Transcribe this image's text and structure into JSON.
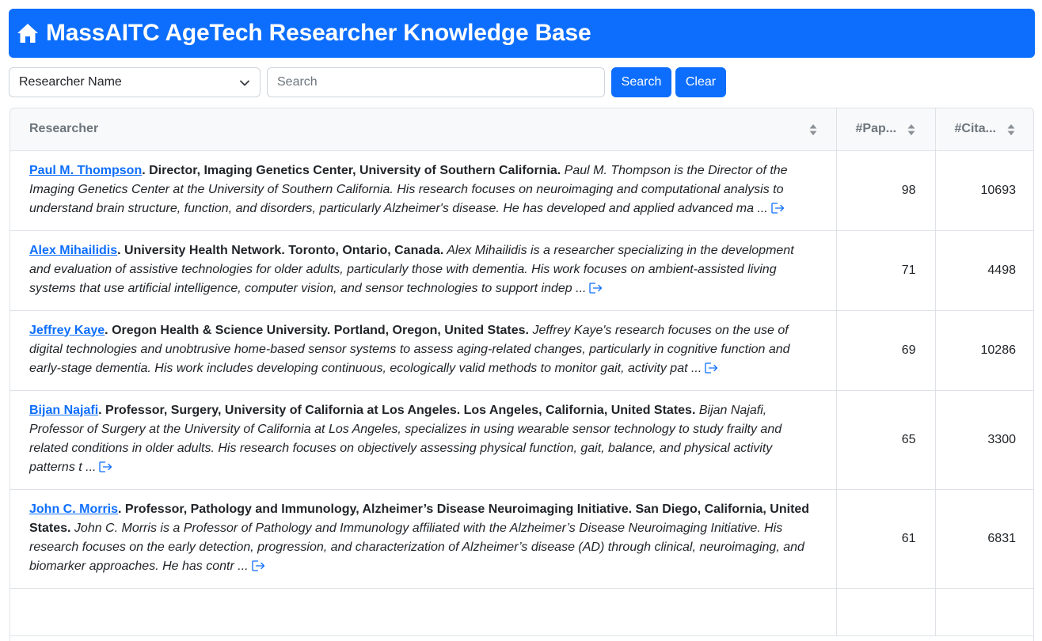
{
  "header": {
    "title": "MassAITC AgeTech Researcher Knowledge Base",
    "icon": "home-icon",
    "color": "#0d6efd"
  },
  "controls": {
    "field_select": {
      "selected": "Researcher Name"
    },
    "search": {
      "placeholder": "Search",
      "value": ""
    },
    "search_button": "Search",
    "clear_button": "Clear"
  },
  "table": {
    "columns": [
      "Researcher",
      "#Pap...",
      "#Cita..."
    ],
    "rows": [
      {
        "name": "Paul M. Thompson",
        "affiliation": ". Director, Imaging Genetics Center, University of Southern California.",
        "bio": " Paul M. Thompson is the Director of the Imaging Genetics Center at the University of Southern California. His research focuses on neuroimaging and computational analysis to understand brain structure, function, and disorders, particularly Alzheimer's disease. He has developed and applied advanced ma ...",
        "papers": "98",
        "citations": "10693"
      },
      {
        "name": "Alex Mihailidis",
        "affiliation": ". University Health Network. Toronto, Ontario, Canada.",
        "bio": " Alex Mihailidis is a researcher specializing in the development and evaluation of assistive technologies for older adults, particularly those with dementia. His work focuses on ambient-assisted living systems that use artificial intelligence, computer vision, and sensor technologies to support indep ...",
        "papers": "71",
        "citations": "4498"
      },
      {
        "name": "Jeffrey Kaye",
        "affiliation": ". Oregon Health & Science University. Portland, Oregon, United States.",
        "bio": " Jeffrey Kaye's research focuses on the use of digital technologies and unobtrusive home-based sensor systems to assess aging-related changes, particularly in cognitive function and early-stage dementia. His work includes developing continuous, ecologically valid methods to monitor gait, activity pat ...",
        "papers": "69",
        "citations": "10286"
      },
      {
        "name": "Bijan Najafi",
        "affiliation": ". Professor, Surgery, University of California at Los Angeles. Los Angeles, California, United States.",
        "bio": " Bijan Najafi, Professor of Surgery at the University of California at Los Angeles, specializes in using wearable sensor technology to study frailty and related conditions in older adults. His research focuses on objectively assessing physical function, gait, balance, and physical activity patterns t ...",
        "papers": "65",
        "citations": "3300"
      },
      {
        "name": "John C. Morris",
        "affiliation": ". Professor, Pathology and Immunology, Alzheimer’s Disease Neuroimaging Initiative. San Diego, California, United States.",
        "bio": " John C. Morris is a Professor of Pathology and Immunology affiliated with the Alzheimer’s Disease Neuroimaging Initiative. His research focuses on the early detection, progression, and characterization of Alzheimer’s disease (AD) through clinical, neuroimaging, and biomarker approaches. He has contr ...",
        "papers": "61",
        "citations": "6831"
      },
      {
        "name": "",
        "affiliation": "",
        "bio": "",
        "papers": "",
        "citations": ""
      }
    ]
  }
}
